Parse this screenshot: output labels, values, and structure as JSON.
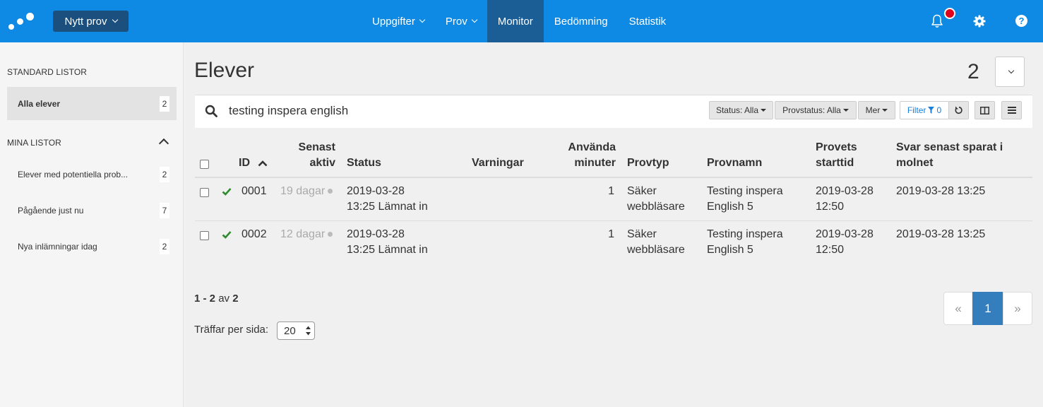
{
  "topbar": {
    "new_exam_label": "Nytt prov",
    "nav": [
      {
        "label": "Uppgifter",
        "has_dropdown": true
      },
      {
        "label": "Prov",
        "has_dropdown": true
      },
      {
        "label": "Monitor",
        "active": true
      },
      {
        "label": "Bedömning"
      },
      {
        "label": "Statistik"
      }
    ],
    "icons": [
      "bell-icon",
      "gear-icon",
      "help-icon"
    ],
    "accent_color": "#0e8ae5",
    "notification_color": "#e0001b"
  },
  "sidebar": {
    "standard_header": "STANDARD LISTOR",
    "standard_items": [
      {
        "label": "Alla elever",
        "count": "2",
        "active": true
      }
    ],
    "mine_header": "MINA LISTOR",
    "mine_items": [
      {
        "label": "Elever med potentiella prob...",
        "count": "2"
      },
      {
        "label": "Pågående just nu",
        "count": "7"
      },
      {
        "label": "Nya inlämningar idag",
        "count": "2"
      }
    ]
  },
  "main": {
    "title": "Elever",
    "total": "2",
    "search": {
      "value": "testing inspera english",
      "placeholder": ""
    },
    "filters": {
      "status": "Status: Alla",
      "exam_status": "Provstatus: Alla",
      "more": "Mer",
      "filter_label": "Filter",
      "filter_count": "0"
    },
    "columns": {
      "id": "ID",
      "last_active_1": "Senast",
      "last_active_2": "aktiv",
      "status": "Status",
      "warnings": "Varningar",
      "minutes_1": "Använda",
      "minutes_2": "minuter",
      "exam_type": "Provtyp",
      "exam_name": "Provnamn",
      "start_1": "Provets",
      "start_2": "starttid",
      "saved_1": "Svar senast sparat i",
      "saved_2": "molnet"
    },
    "rows": [
      {
        "id": "0001",
        "last_active": "19 dagar",
        "status_1": "2019-03-28",
        "status_2": "13:25 Lämnat in",
        "warnings": "",
        "minutes": "1",
        "type_1": "Säker",
        "type_2": "webbläsare",
        "name_1": "Testing inspera",
        "name_2": "English 5",
        "start_1": "2019-03-28",
        "start_2": "12:50",
        "saved": "2019-03-28 13:25"
      },
      {
        "id": "0002",
        "last_active": "12 dagar",
        "status_1": "2019-03-28",
        "status_2": "13:25 Lämnat in",
        "warnings": "",
        "minutes": "1",
        "type_1": "Säker",
        "type_2": "webbläsare",
        "name_1": "Testing inspera",
        "name_2": "English 5",
        "start_1": "2019-03-28",
        "start_2": "12:50",
        "saved": "2019-03-28 13:25"
      }
    ],
    "pagination": {
      "range_from_to": "1 - 2",
      "range_of": "av",
      "range_total": "2",
      "per_page_label": "Träffar per sida:",
      "per_page_value": "20",
      "prev": "«",
      "current": "1",
      "next": "»"
    }
  }
}
